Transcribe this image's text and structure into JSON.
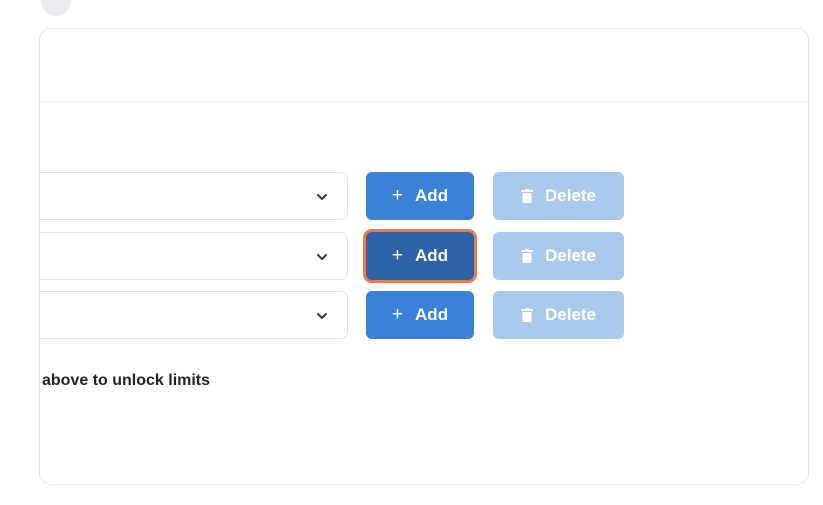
{
  "rows": [
    {
      "add_label": "Add",
      "delete_label": "Delete",
      "focused": false
    },
    {
      "add_label": "Add",
      "delete_label": "Delete",
      "focused": true
    },
    {
      "add_label": "Add",
      "delete_label": "Delete",
      "focused": false
    }
  ],
  "icons": {
    "add": "plus-icon",
    "delete": "trash-icon",
    "select": "chevron-down-icon"
  },
  "hint_text": "above to unlock limits",
  "colors": {
    "primary": "#3b82d6",
    "primary_active": "#2f63a8",
    "focus_ring": "#f07a4a",
    "delete_disabled": "#a8c9ec"
  }
}
